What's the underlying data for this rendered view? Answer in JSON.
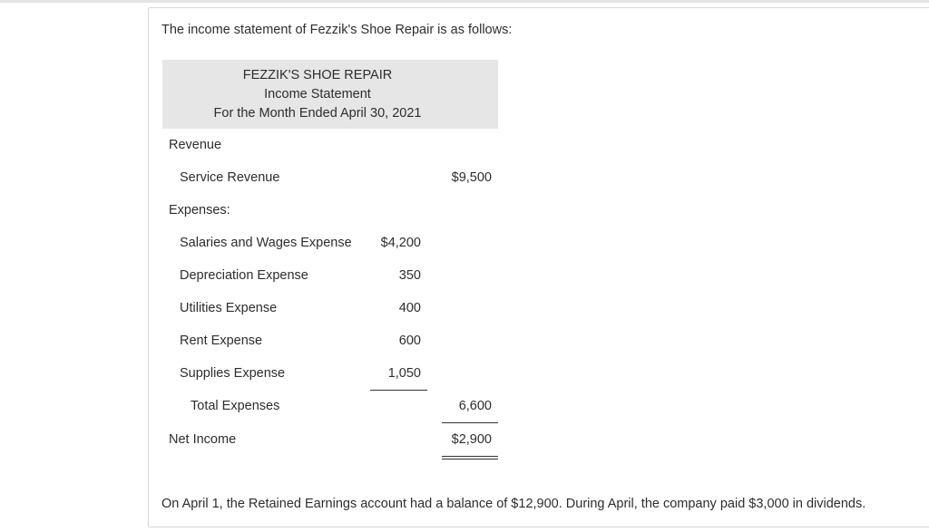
{
  "intro": "The income statement of Fezzik's Shoe Repair is as follows:",
  "statement": {
    "company": "FEZZIK'S SHOE REPAIR",
    "title": "Income Statement",
    "period": "For the Month Ended April 30, 2021",
    "revenue_heading": "Revenue",
    "revenue_items": [
      {
        "label": "Service Revenue",
        "amount": "$9,500"
      }
    ],
    "expenses_heading": "Expenses:",
    "expense_items": [
      {
        "label": "Salaries and Wages Expense",
        "amount": "$4,200"
      },
      {
        "label": "Depreciation Expense",
        "amount": "350"
      },
      {
        "label": "Utilities Expense",
        "amount": "400"
      },
      {
        "label": "Rent Expense",
        "amount": "600"
      },
      {
        "label": "Supplies Expense",
        "amount": "1,050"
      }
    ],
    "total_expenses_label": "Total Expenses",
    "total_expenses_amount": "6,600",
    "net_income_label": "Net Income",
    "net_income_amount": "$2,900"
  },
  "footer": "On April 1, the Retained Earnings account had a balance of $12,900. During April, the company paid $3,000 in dividends."
}
